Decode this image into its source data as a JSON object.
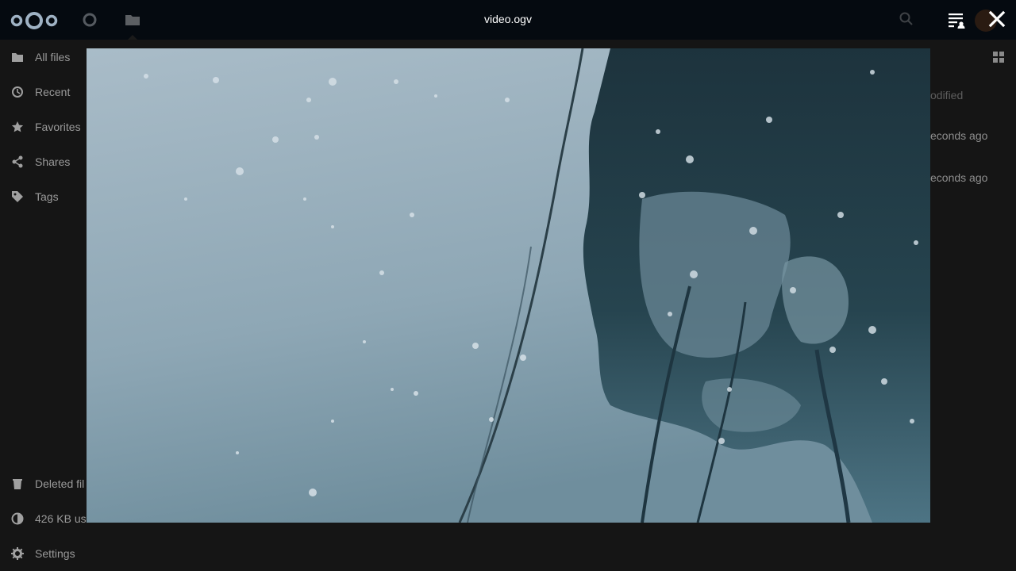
{
  "viewer": {
    "title": "video.ogv"
  },
  "header": {
    "icons": [
      "nextcloud-logo",
      "dashboard-icon",
      "files-icon",
      "search-icon",
      "sidebar-toggle-icon",
      "close-icon"
    ]
  },
  "sidebar": {
    "items": [
      {
        "label": "All files",
        "icon": "folder-icon"
      },
      {
        "label": "Recent",
        "icon": "clock-icon"
      },
      {
        "label": "Favorites",
        "icon": "star-icon"
      },
      {
        "label": "Shares",
        "icon": "share-icon"
      },
      {
        "label": "Tags",
        "icon": "tag-icon"
      }
    ],
    "bottom": {
      "deleted": "Deleted fil",
      "quota": "426 KB us",
      "settings": "Settings"
    }
  },
  "file_list": {
    "modified_header": "odified",
    "row1_modified": "econds ago",
    "row2_modified": "econds ago"
  },
  "colors": {
    "header_bg": "#050a10",
    "page_bg": "#151515"
  }
}
